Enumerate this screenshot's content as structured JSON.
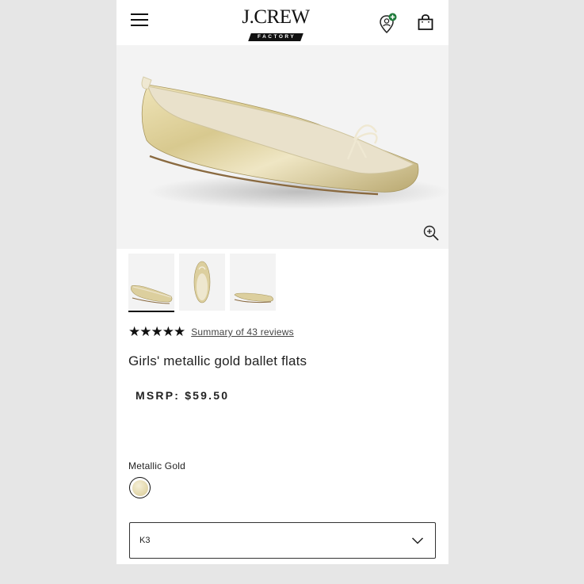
{
  "header": {
    "menu_icon": "hamburger-menu-icon",
    "logo_text": "J.CREW",
    "logo_subtext": "FACTORY",
    "account_icon": "account-pin-icon",
    "bag_icon": "shopping-bag-icon"
  },
  "product": {
    "title": "Girls' metallic gold ballet flats",
    "price": "MSRP: $59.50",
    "rating_stars": "★★★★★",
    "rating_value": 5,
    "reviews_link": "Summary of 43 reviews",
    "zoom_icon": "zoom-in-icon"
  },
  "gallery": {
    "thumbnails": [
      "side-view",
      "top-view",
      "profile-view"
    ],
    "selected_index": 0
  },
  "color": {
    "label": "Metallic Gold",
    "swatch_color": "#e4d9ae"
  },
  "size": {
    "selected": "K3",
    "chevron_icon": "chevron-down-icon"
  },
  "colors": {
    "background": "#e6e6e6",
    "page": "#ffffff",
    "text": "#222222",
    "badge_green": "#1e7a3a"
  }
}
